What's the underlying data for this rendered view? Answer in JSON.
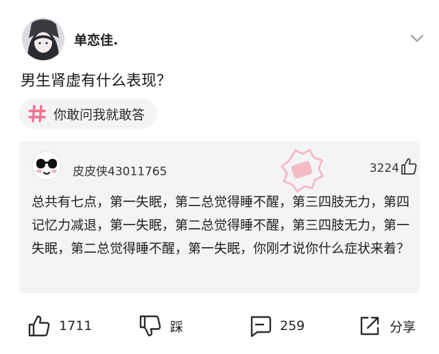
{
  "post": {
    "username": "单恋佳.",
    "question": "男生肾虚有什么表现？",
    "topic": "你敢问我就敢答"
  },
  "comment": {
    "username": "皮皮侠43011765",
    "likes": "3224",
    "text": "总共有七点，第一失眠，第二总觉得睡不醒，第三四肢无力，第四记忆力减退，第一失眠，第二总觉得睡不醒，第三四肢无力，第一失眠，第二总觉得睡不醒，第一失眠，你刚才说你什么症状来着？"
  },
  "actions": {
    "like_count": "1711",
    "dislike_label": "踩",
    "comment_count": "259",
    "share_label": "分享"
  },
  "colors": {
    "topic_hash": "#f2708f",
    "stamp": "#f5a3b3",
    "card_bg": "#f4f4f6"
  },
  "icons": [
    "chevron-down-icon",
    "hashtag-icon",
    "thumb-up-icon",
    "thumb-down-icon",
    "comment-icon",
    "share-icon"
  ]
}
